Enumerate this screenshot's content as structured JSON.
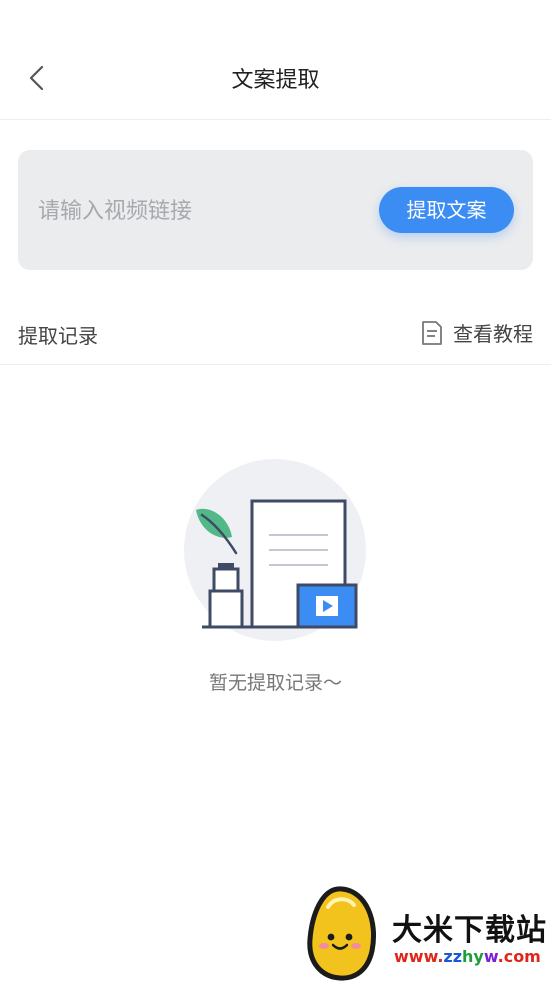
{
  "header": {
    "title": "文案提取"
  },
  "extract": {
    "placeholder": "请输入视频链接",
    "button_label": "提取文案"
  },
  "records": {
    "section_label": "提取记录",
    "tutorial_label": "查看教程",
    "empty_text": "暂无提取记录～"
  },
  "watermark": {
    "brand_text": "大米下载站",
    "url_parts": [
      "www.",
      "zz",
      "hy",
      "w",
      ".com"
    ],
    "url_colors": [
      "#e0261b",
      "#1a57d6",
      "#1f9d3a",
      "#7a1fd6",
      "#e0261b"
    ]
  },
  "colors": {
    "accent": "#3b8cf3",
    "card_bg": "#ebecee",
    "placeholder": "#a6a9ae"
  },
  "icons": {
    "back": "chevron-left-icon",
    "tutorial": "document-icon"
  }
}
